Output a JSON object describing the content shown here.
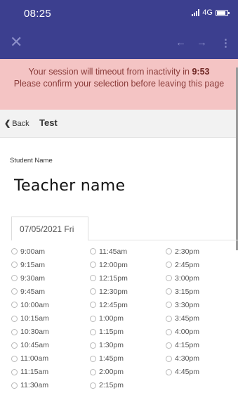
{
  "status_bar": {
    "time": "08:25",
    "network": "4G"
  },
  "session_banner": {
    "message": "Your session will timeout from inactivity in ",
    "countdown": "9:53",
    "message_line2": "Please confirm your selection before leaving this page"
  },
  "nav": {
    "back_label": "Back",
    "title": "Test"
  },
  "form": {
    "student_label": "Student Name",
    "student_value": "Teacher name"
  },
  "date_tab": {
    "label": "07/05/2021 Fri"
  },
  "time_slots": {
    "col1": [
      "9:00am",
      "9:15am",
      "9:30am",
      "9:45am",
      "10:00am",
      "10:15am",
      "10:30am",
      "10:45am",
      "11:00am",
      "11:15am",
      "11:30am"
    ],
    "col2": [
      "11:45am",
      "12:00pm",
      "12:15pm",
      "12:30pm",
      "12:45pm",
      "1:00pm",
      "1:15pm",
      "1:30pm",
      "1:45pm",
      "2:00pm",
      "2:15pm"
    ],
    "col3": [
      "2:30pm",
      "2:45pm",
      "3:00pm",
      "3:15pm",
      "3:30pm",
      "3:45pm",
      "4:00pm",
      "4:15pm",
      "4:30pm",
      "4:45pm"
    ]
  },
  "colors": {
    "header": "#3c3f8f",
    "banner_bg": "#f4c4c4",
    "banner_text": "#8a3c3a"
  }
}
